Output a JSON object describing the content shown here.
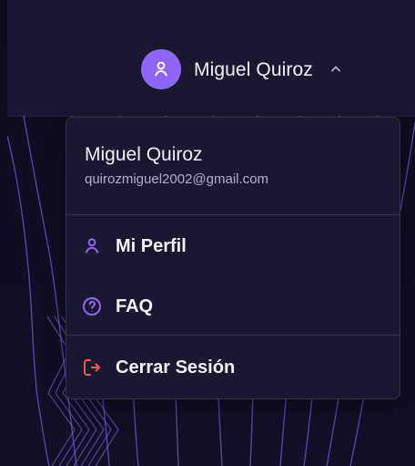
{
  "header": {
    "user_name": "Miguel Quiroz"
  },
  "menu": {
    "name": "Miguel Quiroz",
    "email": "quirozmiguel2002@gmail.com",
    "items": [
      {
        "label": "Mi Perfil",
        "icon": "user-icon"
      },
      {
        "label": "FAQ",
        "icon": "question-circle-icon"
      },
      {
        "label": "Cerrar Sesión",
        "icon": "logout-icon"
      }
    ]
  },
  "colors": {
    "avatar_bg": "#8f65f5",
    "accent": "#8f65f5",
    "logout": "#ef5b4f",
    "text": "#f4f2ff",
    "muted": "#b4aec9",
    "panel": "#1b1731",
    "background": "#121022"
  }
}
